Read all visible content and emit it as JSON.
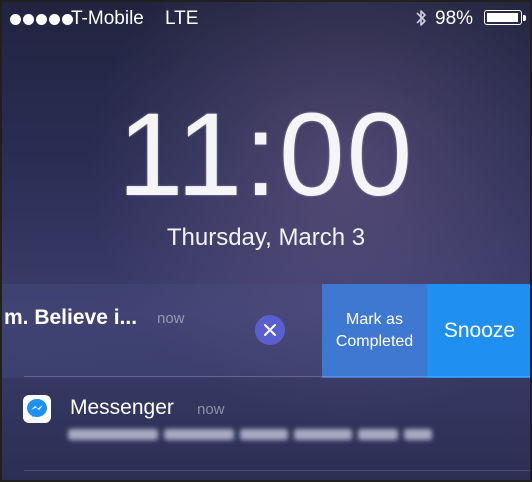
{
  "status_bar": {
    "carrier": "T-Mobile",
    "network": "LTE",
    "battery_percent_label": "98%",
    "battery_level": 0.98,
    "signal_bars": 5
  },
  "lock_screen": {
    "time": "11:00",
    "date": "Thursday, March 3"
  },
  "notifications": [
    {
      "text": "m. Believe i...",
      "time": "now",
      "actions": {
        "dismiss_icon": "close-circle-icon",
        "complete_label": "Mark as Completed",
        "snooze_label": "Snooze"
      }
    },
    {
      "app": "Messenger",
      "time": "now",
      "icon": "messenger-icon"
    }
  ],
  "colors": {
    "complete": "#3f78d0",
    "snooze": "#1f8ff0",
    "dismiss": "#5a5fd0"
  }
}
